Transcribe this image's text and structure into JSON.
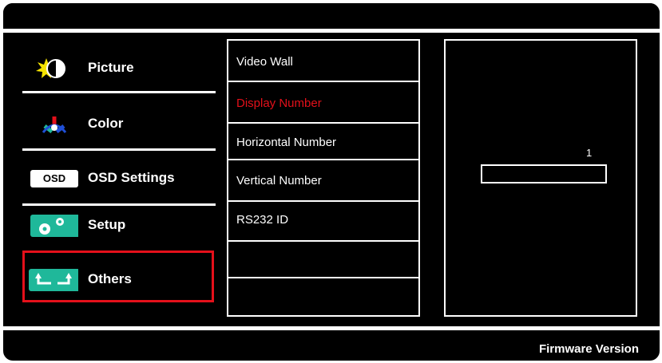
{
  "main_menu": {
    "items": [
      {
        "label": "Picture",
        "icon": "brightness-contrast-icon"
      },
      {
        "label": "Color",
        "icon": "rgb-color-icon"
      },
      {
        "label": "OSD Settings",
        "icon": "osd-icon",
        "icon_text": "OSD"
      },
      {
        "label": "Setup",
        "icon": "gears-icon"
      },
      {
        "label": "Others",
        "icon": "arrows-icon",
        "selected": true
      }
    ]
  },
  "submenu": {
    "items": [
      {
        "label": "Video Wall"
      },
      {
        "label": "Display Number",
        "active": true
      },
      {
        "label": "Horizontal Number"
      },
      {
        "label": "Vertical Number"
      },
      {
        "label": "RS232 ID"
      }
    ]
  },
  "value_panel": {
    "value": "1"
  },
  "footer": {
    "firmware_label": "Firmware Version"
  },
  "colors": {
    "background": "#000000",
    "highlight": "#e4101a",
    "icon_accent": "#1fb89a"
  }
}
